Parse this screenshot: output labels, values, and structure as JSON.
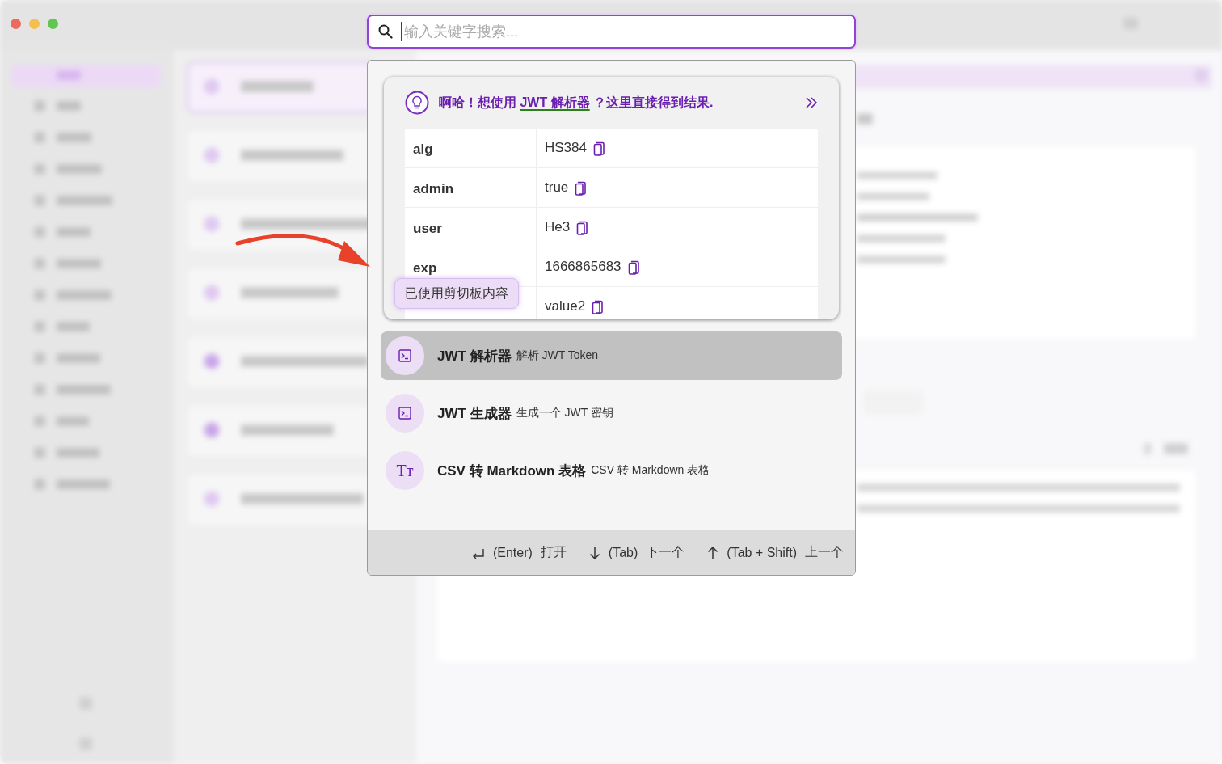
{
  "search": {
    "placeholder": "输入关键字搜索..."
  },
  "hint": {
    "before": "啊哈！想使用 ",
    "link": "JWT 解析器",
    "after": " ？这里直接得到结果.",
    "rows": [
      {
        "key": "alg",
        "value": "HS384"
      },
      {
        "key": "admin",
        "value": "true"
      },
      {
        "key": "user",
        "value": "He3"
      },
      {
        "key": "exp",
        "value": "1666865683"
      },
      {
        "value": "value2"
      }
    ]
  },
  "toast": "已使用剪切板内容",
  "results": [
    {
      "title": "JWT 解析器",
      "description": "解析 JWT Token",
      "kind": "terminal",
      "selected": true
    },
    {
      "title": "JWT 生成器",
      "description": "生成一个 JWT 密钥",
      "kind": "terminal",
      "selected": false
    },
    {
      "title": "CSV 转 Markdown 表格",
      "description": "CSV 转 Markdown 表格",
      "kind": "glyph",
      "glyph": "Tт",
      "selected": false
    }
  ],
  "shortcuts": [
    {
      "kind": "enter",
      "key": "(Enter)",
      "action": "打开"
    },
    {
      "kind": "down",
      "key": "(Tab)",
      "action": "下一个"
    },
    {
      "kind": "up",
      "key": "(Tab + Shift)",
      "action": "上一个"
    }
  ]
}
